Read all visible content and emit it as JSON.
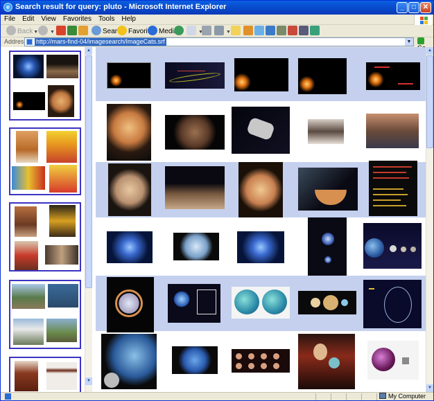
{
  "window": {
    "title": "Search result for query: pluto - Microsoft Internet Explorer",
    "app_icon": "internet-explorer-icon"
  },
  "title_buttons": {
    "minimize": "_",
    "maximize": "□",
    "close": "✕"
  },
  "menu": [
    "File",
    "Edit",
    "View",
    "Favorites",
    "Tools",
    "Help"
  ],
  "toolbar": {
    "back": "Back",
    "search": "Search",
    "favorites": "Favorites",
    "media": "Media"
  },
  "address": {
    "label": "Address",
    "url": "http://mars-find-04/imagesearch/ImageCats.srf",
    "go": "Go"
  },
  "status": {
    "zone": "My Computer"
  },
  "colors": {
    "title_blue": "#0a4fd4",
    "cluster_border": "#3b33c2",
    "row_band": "#c4d0ee"
  },
  "left_clusters": [
    {
      "theme": "planetary",
      "thumbs": [
        "blue-glow",
        "mars-landscape",
        "orange-dot-dark",
        "planet-with-moons"
      ]
    },
    {
      "theme": "disney-pluto",
      "thumbs": [
        "pluto-figurine",
        "pluto-comic-cover",
        "mickey-and-pluto",
        "pluto-poster"
      ]
    },
    {
      "theme": "people",
      "thumbs": [
        "wrestler",
        "championship-poster",
        "person-in-red",
        "group-photo"
      ]
    },
    {
      "theme": "observatory",
      "thumbs": [
        "park-trees",
        "info-sign",
        "dome-building",
        "signpost"
      ]
    },
    {
      "theme": "furniture",
      "thumbs": [
        "wooden-box",
        "table"
      ]
    }
  ]
}
